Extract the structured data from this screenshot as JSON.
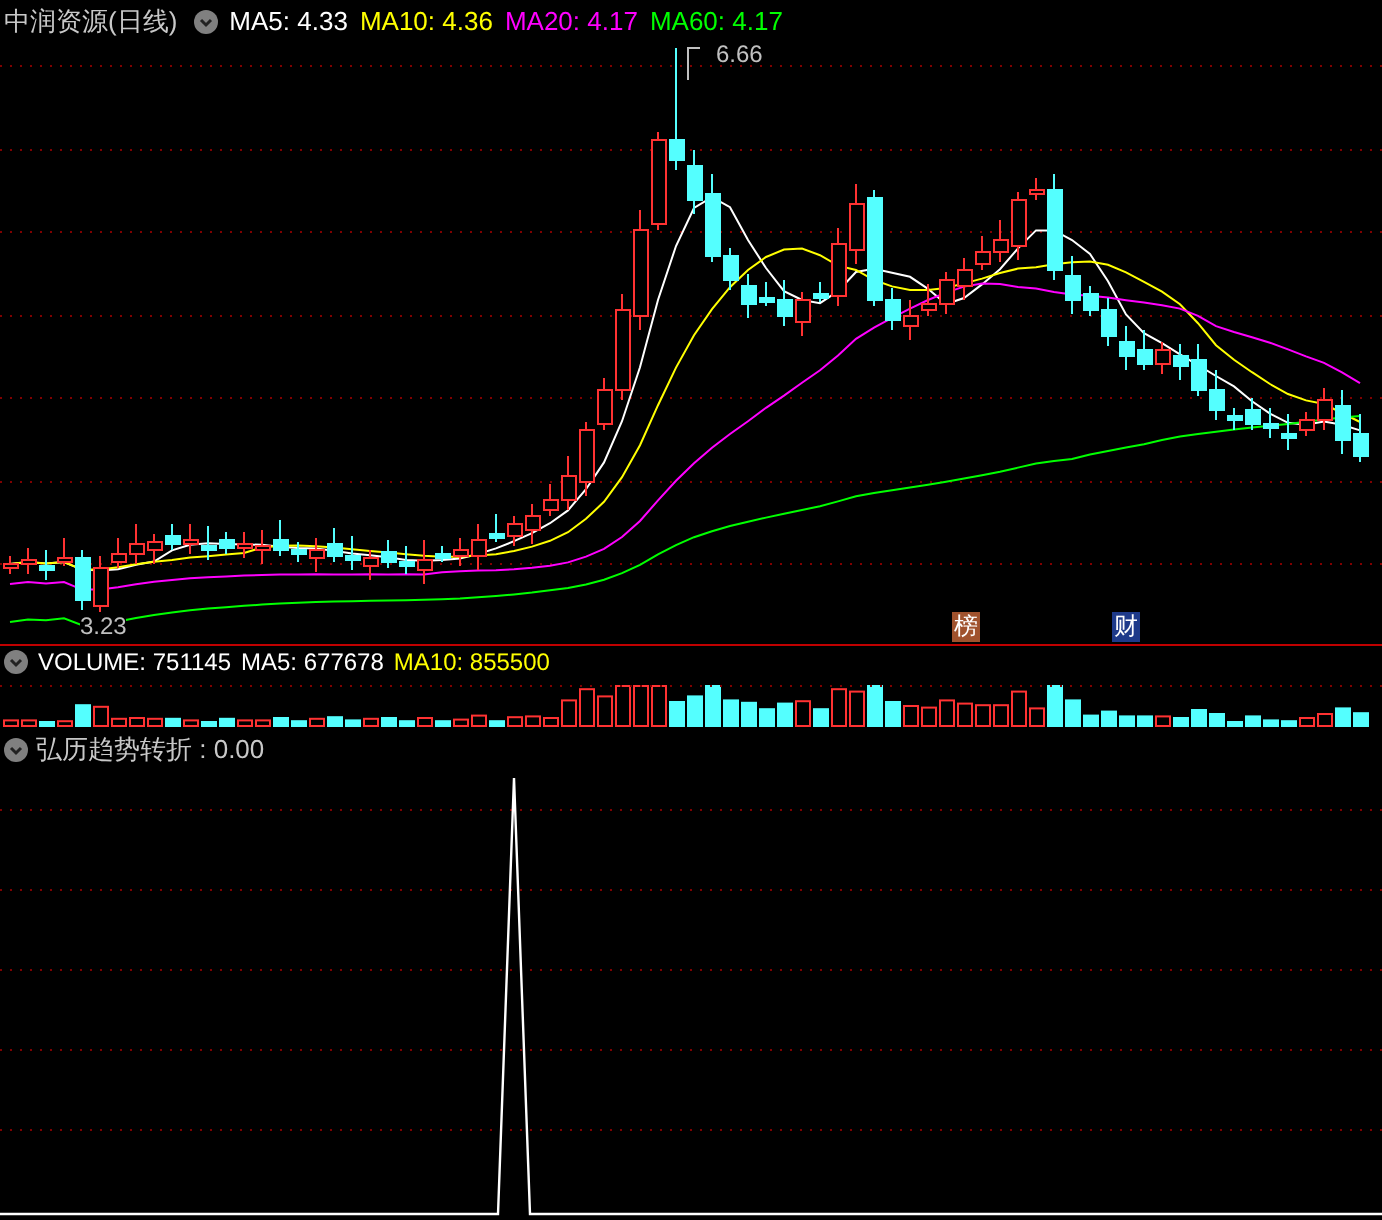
{
  "header": {
    "title": "中润资源(日线)",
    "legend": [
      {
        "label": "MA5: 4.33",
        "color": "#ffffff"
      },
      {
        "label": "MA10: 4.36",
        "color": "#ffff00"
      },
      {
        "label": "MA20: 4.17",
        "color": "#ff00ff"
      },
      {
        "label": "MA60: 4.17",
        "color": "#00ff00"
      }
    ]
  },
  "price_chart": {
    "high_label": "6.66",
    "low_label": "3.23",
    "badges": [
      {
        "text": "榜",
        "color": "#a0522d"
      },
      {
        "text": "财",
        "color": "#1e3a8a"
      }
    ]
  },
  "volume_header": {
    "legend": [
      {
        "label": "VOLUME: 751145",
        "color": "#ffffff"
      },
      {
        "label": "MA5: 677678",
        "color": "#ffffff"
      },
      {
        "label": "MA10: 855500",
        "color": "#ffff00"
      }
    ]
  },
  "indicator_header": {
    "label": "弘历趋势转折 : 0.00"
  }
}
